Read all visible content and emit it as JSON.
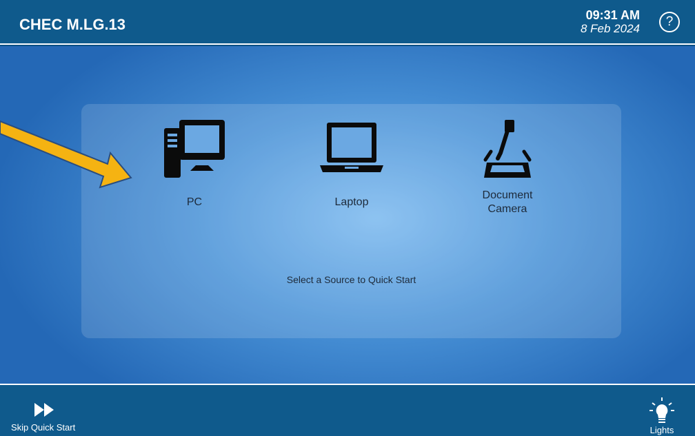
{
  "header": {
    "room_title": "CHEC M.LG.13",
    "time": "09:31 AM",
    "date": "8 Feb 2024",
    "help_glyph": "?"
  },
  "panel": {
    "sources": [
      {
        "label": "PC",
        "icon": "desktop-computer-icon"
      },
      {
        "label": "Laptop",
        "icon": "laptop-icon"
      },
      {
        "label_line1": "Document",
        "label_line2": "Camera",
        "icon": "document-camera-icon"
      }
    ],
    "prompt": "Select a Source to Quick Start"
  },
  "footer": {
    "skip_label": "Skip Quick Start",
    "lights_label": "Lights"
  },
  "colors": {
    "bar": "#0f5a8c",
    "stage_center": "#7bb9ef",
    "stage_edge": "#2468b6",
    "annotation_arrow": "#f5b312",
    "icon": "#0b0b0b"
  }
}
